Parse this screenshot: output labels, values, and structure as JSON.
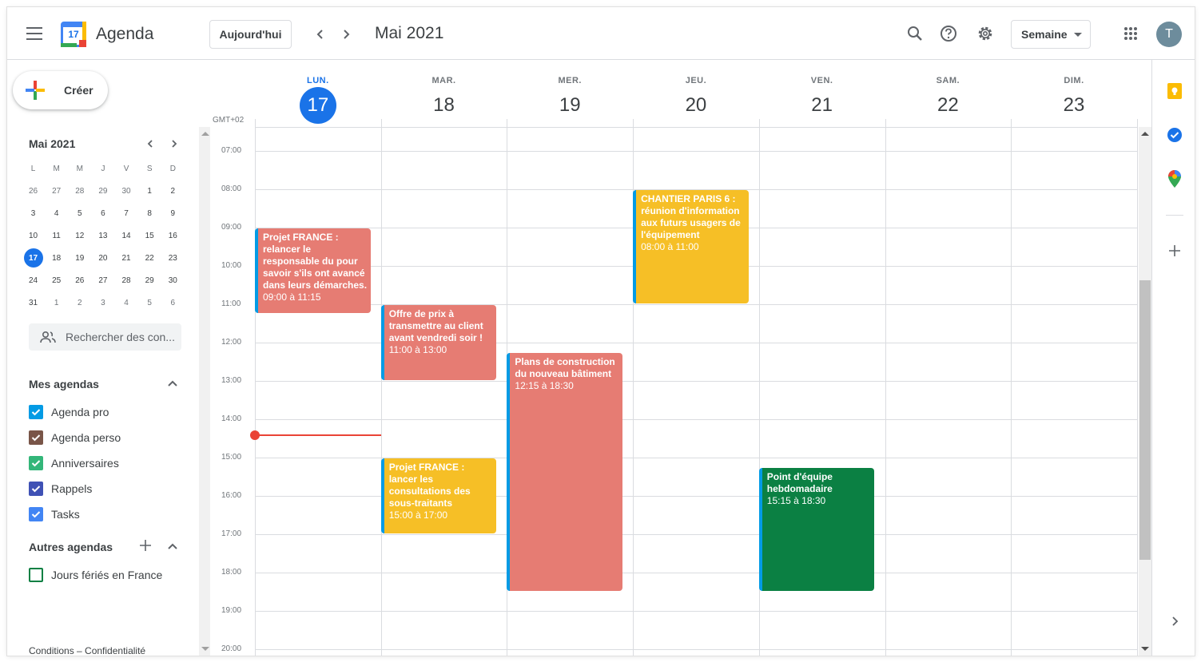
{
  "header": {
    "app_title": "Agenda",
    "logo_number": "17",
    "today_label": "Aujourd'hui",
    "month_title": "Mai 2021",
    "view_label": "Semaine",
    "avatar_initial": "T",
    "icons": [
      "menu-icon",
      "chevron-left-icon",
      "chevron-right-icon",
      "search-icon",
      "help-icon",
      "settings-icon",
      "apps-grid-icon"
    ]
  },
  "sidebar": {
    "create_label": "Créer",
    "mini_calendar": {
      "title": "Mai 2021",
      "weekdays": [
        "L",
        "M",
        "M",
        "J",
        "V",
        "S",
        "D"
      ],
      "weeks": [
        [
          "26",
          "27",
          "28",
          "29",
          "30",
          "1",
          "2"
        ],
        [
          "3",
          "4",
          "5",
          "6",
          "7",
          "8",
          "9"
        ],
        [
          "10",
          "11",
          "12",
          "13",
          "14",
          "15",
          "16"
        ],
        [
          "17",
          "18",
          "19",
          "20",
          "21",
          "22",
          "23"
        ],
        [
          "24",
          "25",
          "26",
          "27",
          "28",
          "29",
          "30"
        ],
        [
          "31",
          "1",
          "2",
          "3",
          "4",
          "5",
          "6"
        ]
      ],
      "today": "17"
    },
    "people_search_placeholder": "Rechercher des con...",
    "my_calendars_title": "Mes agendas",
    "my_calendars": [
      {
        "label": "Agenda pro",
        "color": "#039be5",
        "checked": true
      },
      {
        "label": "Agenda perso",
        "color": "#795548",
        "checked": true
      },
      {
        "label": "Anniversaires",
        "color": "#33b679",
        "checked": true
      },
      {
        "label": "Rappels",
        "color": "#3f51b5",
        "checked": true
      },
      {
        "label": "Tasks",
        "color": "#4285f4",
        "checked": true
      }
    ],
    "other_calendars_title": "Autres agendas",
    "other_calendars": [
      {
        "label": "Jours fériés en France",
        "color": "#0b8043",
        "checked": false
      }
    ],
    "footer": "Conditions – Confidentialité"
  },
  "week": {
    "timezone": "GMT+02",
    "days": [
      {
        "abbr": "LUN.",
        "num": "17",
        "today": true
      },
      {
        "abbr": "MAR.",
        "num": "18",
        "today": false
      },
      {
        "abbr": "MER.",
        "num": "19",
        "today": false
      },
      {
        "abbr": "JEU.",
        "num": "20",
        "today": false
      },
      {
        "abbr": "VEN.",
        "num": "21",
        "today": false
      },
      {
        "abbr": "SAM.",
        "num": "22",
        "today": false
      },
      {
        "abbr": "DIM.",
        "num": "23",
        "today": false
      }
    ],
    "hours": [
      "07:00",
      "08:00",
      "09:00",
      "10:00",
      "11:00",
      "12:00",
      "13:00",
      "14:00",
      "15:00",
      "16:00",
      "17:00",
      "18:00",
      "19:00",
      "20:00"
    ],
    "current_time": "14:25"
  },
  "events": [
    {
      "day": 0,
      "title": "Projet FRANCE : relancer le responsable du pour savoir s'ils ont avancé dans leurs démarches.",
      "time": "09:00 à 11:15",
      "start": "09:00",
      "end": "11:15",
      "color": "#e67c73"
    },
    {
      "day": 1,
      "title": "Offre de prix à transmettre au client avant vendredi soir !",
      "time": "11:00 à 13:00",
      "start": "11:00",
      "end": "13:00",
      "color": "#e67c73"
    },
    {
      "day": 1,
      "title": "Projet FRANCE : lancer les consultations des sous-traitants",
      "time": "15:00 à 17:00",
      "start": "15:00",
      "end": "17:00",
      "color": "#f6bf26"
    },
    {
      "day": 2,
      "title": "Plans de construction du nouveau bâtiment",
      "time": "12:15 à 18:30",
      "start": "12:15",
      "end": "18:30",
      "color": "#e67c73"
    },
    {
      "day": 3,
      "title": "CHANTIER PARIS 6 : réunion d'information aux futurs usagers de l'équipement",
      "time": "08:00 à 11:00",
      "start": "08:00",
      "end": "11:00",
      "color": "#f6bf26"
    },
    {
      "day": 4,
      "title": "Point d'équipe hebdomadaire",
      "time": "15:15 à 18:30",
      "start": "15:15",
      "end": "18:30",
      "color": "#0b8043"
    }
  ],
  "right_panel": {
    "icons": [
      "keep-icon",
      "tasks-icon",
      "maps-icon",
      "add-addon-icon",
      "expand-panel-icon"
    ]
  },
  "colors": {
    "accent": "#1a73e8",
    "now_line": "#ea4335"
  }
}
